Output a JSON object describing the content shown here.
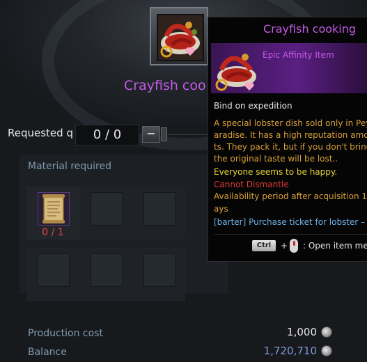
{
  "main_item": {
    "name": "Crayfish cooking",
    "visible_title": "Crayfish coo"
  },
  "request": {
    "label": "Requested q",
    "quantity": "0 / 0",
    "minus_label": "−"
  },
  "materials": {
    "label": "Material required",
    "slots": [
      {
        "filled": true,
        "icon": "scroll-icon",
        "count": "0 / 1"
      },
      {
        "filled": false
      },
      {
        "filled": false
      },
      {
        "filled": false
      },
      {
        "filled": false
      },
      {
        "filled": false
      },
      {
        "filled": false
      },
      {
        "filled": false
      },
      {
        "filled": false
      },
      {
        "filled": false
      }
    ]
  },
  "costs": {
    "production_label": "Production cost",
    "production_value": "1,000",
    "balance_label": "Balance",
    "balance_value": "1,720,710"
  },
  "tooltip": {
    "title": "Crayfish cooking",
    "subtitle": "Epic Affinity Item",
    "bind": "Bind on expedition",
    "description": [
      "A special lobster dish sold only in Pey",
      "aradise. It has a high reputation amo",
      "ts. They pack it, but if you don't bring",
      "the original taste will be lost.."
    ],
    "happy": "Everyone seems to be happy.",
    "dismantle": "Cannot Dismantle",
    "availability": [
      "Availability period after acquisition 1",
      "ays"
    ],
    "barter": "[barter] Purchase ticket for lobster –",
    "ctrl_key": "Ctrl",
    "plus": "+",
    "open_menu": ": Open item me"
  },
  "colors": {
    "epic_purple": "#c45be6",
    "desc_gold": "#d9a037",
    "happy_yellow": "#e8d33a",
    "dismantle_red": "#e53935",
    "barter_blue": "#6fb2e6",
    "count_red": "#e54848",
    "label_blue": "#7f9bb2"
  }
}
